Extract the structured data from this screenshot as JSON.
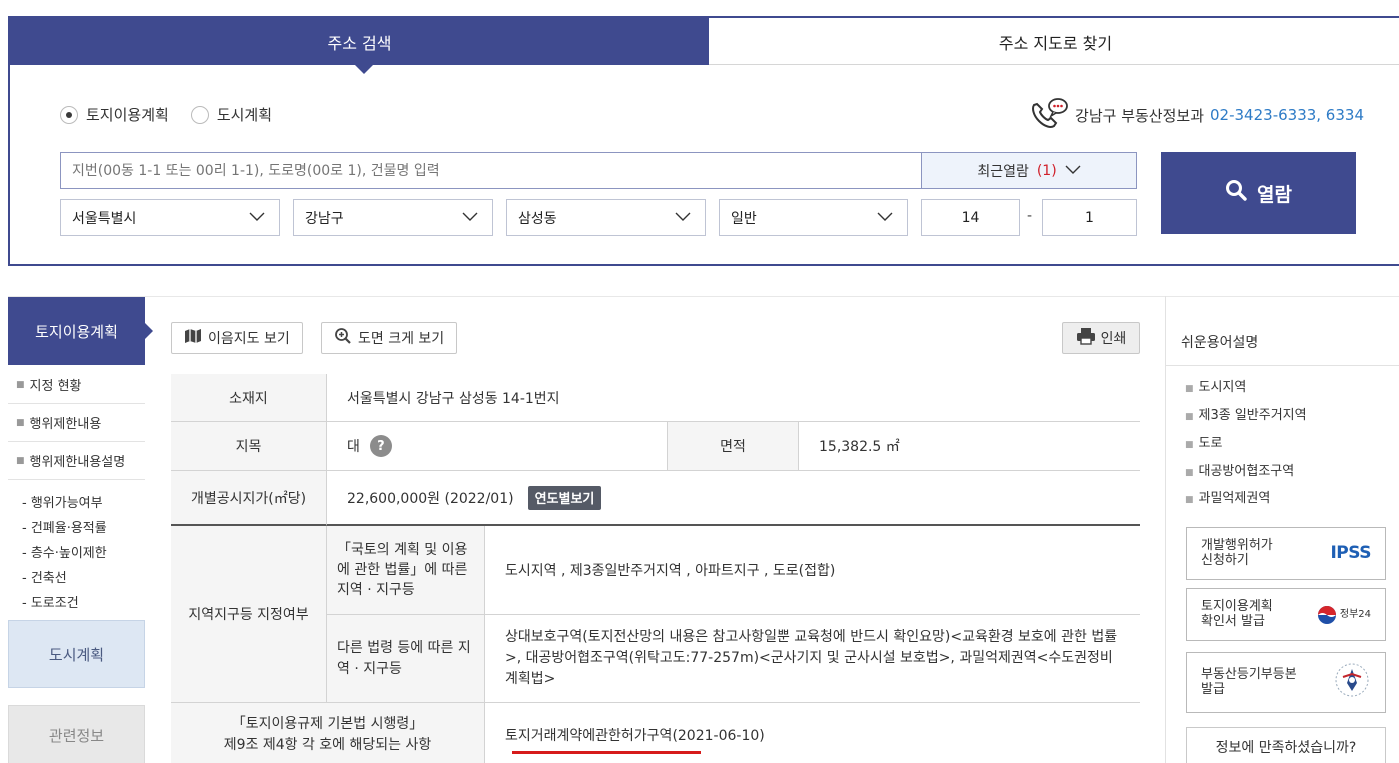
{
  "tabs": {
    "address_search": "주소 검색",
    "map_search": "주소 지도로 찾기"
  },
  "radio": {
    "land_use": "토지이용계획",
    "city_plan": "도시계획",
    "selected": "토지이용계획"
  },
  "contact": {
    "label": "강남구 부동산정보과",
    "phone": "02-3423-6333, 6334"
  },
  "search": {
    "placeholder": "지번(00동 1-1 또는 00리 1-1), 도로명(00로 1), 건물명 입력",
    "recent_label": "최근열람",
    "recent_count": "(1)",
    "view_button": "열람"
  },
  "selects": {
    "city": "서울특별시",
    "district": "강남구",
    "dong": "삼성동",
    "type": "일반"
  },
  "lot": {
    "main": "14",
    "separator": "-",
    "sub": "1"
  },
  "sidebar": {
    "header": "토지이용계획",
    "items": [
      "지정 현황",
      "행위제한내용",
      "행위제한내용설명"
    ],
    "sub_items": [
      "- 행위가능여부",
      "- 건폐율·용적률",
      "- 층수·높이제한",
      "- 건축선",
      "- 도로조건"
    ],
    "city_plan": "도시계획",
    "related": "관련정보"
  },
  "toolbar": {
    "map_view": "이음지도 보기",
    "zoom_view": "도면 크게 보기",
    "print": "인쇄"
  },
  "table": {
    "location_label": "소재지",
    "location_value": "서울특별시 강남구 삼성동 14-1번지",
    "category_label": "지목",
    "category_value": "대",
    "help_glyph": "?",
    "area_label": "면적",
    "area_value": "15,382.5 ㎡",
    "price_label": "개별공시지가(㎡당)",
    "price_value": "22,600,000원 (2022/01)",
    "year_button": "연도별보기",
    "zone_label": "지역지구등 지정여부",
    "law1_label": "「국토의 계획 및 이용에 관한 법률」에 따른 지역 · 지구등",
    "law1_value": "도시지역 , 제3종일반주거지역 , 아파트지구 , 도로(접합)",
    "law2_label": "다른 법령 등에 따른 지역 · 지구등",
    "law2_value": "상대보호구역(토지전산망의 내용은 참고사항일뿐 교육청에 반드시 확인요망)<교육환경 보호에 관한 법률>, 대공방어협조구역(위탁고도:77-257m)<군사기지 및 군사시설 보호법>, 과밀억제권역<수도권정비계획법>",
    "decree_label_1": "「토지이용규제 기본법 시행령」",
    "decree_label_2": "제9조 제4항 각 호에 해당되는 사항",
    "decree_value": "토지거래계약에관한허가구역(2021-06-10)"
  },
  "right": {
    "title": "쉬운용어설명",
    "terms": [
      "도시지역",
      "제3종 일반주거지역",
      "도로",
      "대공방어협조구역",
      "과밀억제권역"
    ],
    "links": [
      {
        "label": "개발행위허가 신청하기",
        "logo": "IPSS"
      },
      {
        "label": "토지이용계획 확인서 발급",
        "logo": "정부24"
      },
      {
        "label": "부동산등기부등본 발급",
        "logo": ""
      }
    ],
    "satisfaction": "정보에 만족하셨습니까?"
  },
  "colors": {
    "primary": "#3f4a8f",
    "phone": "#2e7bc6",
    "count": "#d0202a",
    "underline": "#d61b1b"
  }
}
